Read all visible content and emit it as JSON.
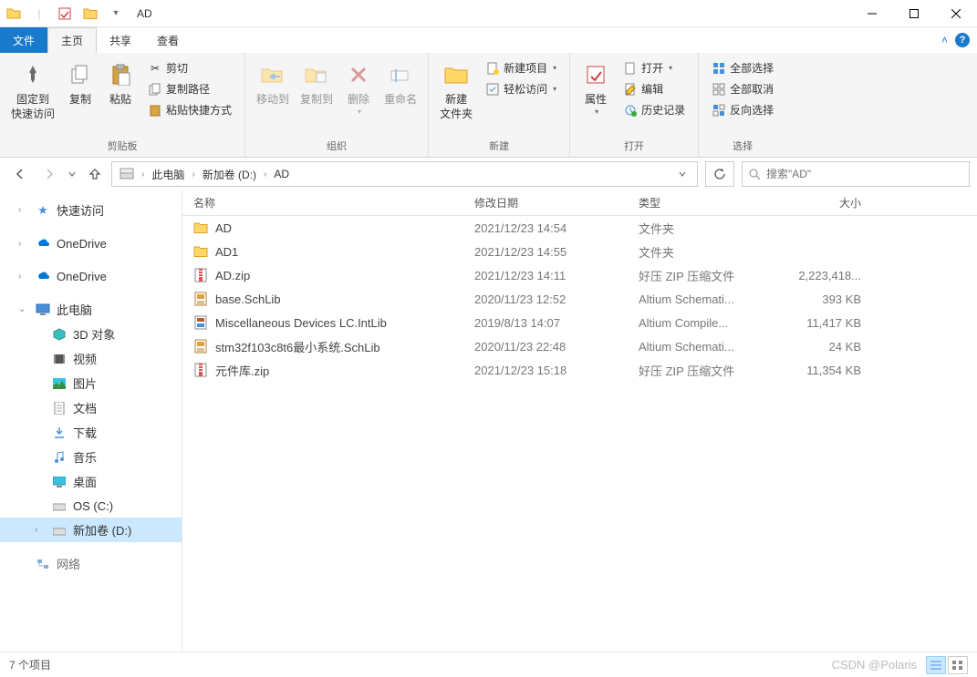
{
  "window": {
    "title": "AD"
  },
  "qat": {
    "dropdown": "▾"
  },
  "tabs": {
    "file": "文件",
    "home": "主页",
    "share": "共享",
    "view": "查看"
  },
  "ribbon": {
    "clipboard": {
      "label": "剪贴板",
      "pin": "固定到\n快速访问",
      "copy": "复制",
      "paste": "粘贴",
      "cut": "剪切",
      "copy_path": "复制路径",
      "paste_shortcut": "粘贴快捷方式"
    },
    "organize": {
      "label": "组织",
      "move_to": "移动到",
      "copy_to": "复制到",
      "delete": "删除",
      "rename": "重命名"
    },
    "new": {
      "label": "新建",
      "new_folder": "新建\n文件夹",
      "new_item": "新建项目",
      "easy_access": "轻松访问"
    },
    "open": {
      "label": "打开",
      "properties": "属性",
      "open": "打开",
      "edit": "编辑",
      "history": "历史记录"
    },
    "select": {
      "label": "选择",
      "select_all": "全部选择",
      "select_none": "全部取消",
      "invert": "反向选择"
    }
  },
  "breadcrumb": {
    "items": [
      "此电脑",
      "新加卷 (D:)",
      "AD"
    ]
  },
  "search": {
    "placeholder": "搜索\"AD\""
  },
  "sidebar": {
    "quick_access": "快速访问",
    "onedrive1": "OneDrive",
    "onedrive2": "OneDrive",
    "this_pc": "此电脑",
    "objects_3d": "3D 对象",
    "videos": "视频",
    "pictures": "图片",
    "documents": "文档",
    "downloads": "下载",
    "music": "音乐",
    "desktop": "桌面",
    "os_c": "OS (C:)",
    "new_vol_d": "新加卷 (D:)",
    "network": "网络"
  },
  "columns": {
    "name": "名称",
    "date": "修改日期",
    "type": "类型",
    "size": "大小"
  },
  "files": [
    {
      "icon": "folder",
      "name": "AD",
      "date": "2021/12/23 14:54",
      "type": "文件夹",
      "size": ""
    },
    {
      "icon": "folder",
      "name": "AD1",
      "date": "2021/12/23 14:55",
      "type": "文件夹",
      "size": ""
    },
    {
      "icon": "zip",
      "name": "AD.zip",
      "date": "2021/12/23 14:11",
      "type": "好压 ZIP 压缩文件",
      "size": "2,223,418..."
    },
    {
      "icon": "schlib",
      "name": "base.SchLib",
      "date": "2020/11/23 12:52",
      "type": "Altium Schemati...",
      "size": "393 KB"
    },
    {
      "icon": "intlib",
      "name": "Miscellaneous Devices LC.IntLib",
      "date": "2019/8/13 14:07",
      "type": "Altium Compile...",
      "size": "11,417 KB"
    },
    {
      "icon": "schlib",
      "name": "stm32f103c8t6最小系统.SchLib",
      "date": "2020/11/23 22:48",
      "type": "Altium Schemati...",
      "size": "24 KB"
    },
    {
      "icon": "zip",
      "name": "元件库.zip",
      "date": "2021/12/23 15:18",
      "type": "好压 ZIP 压缩文件",
      "size": "11,354 KB"
    }
  ],
  "status": {
    "item_count": "7 个项目",
    "watermark": "CSDN @Polaris"
  }
}
